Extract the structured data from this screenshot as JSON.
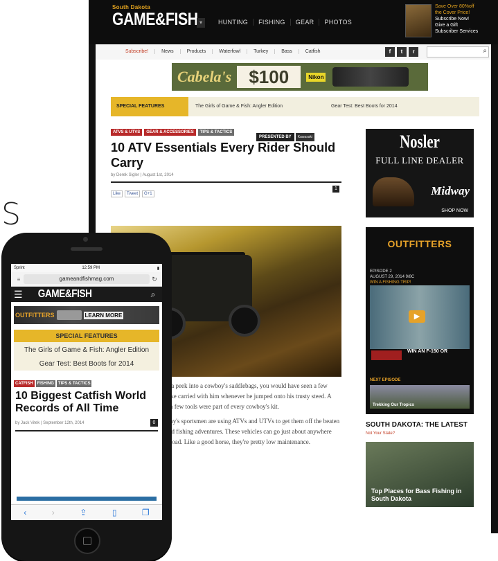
{
  "clip_letter": "S",
  "desktop": {
    "logo_top": "South Dakota",
    "logo_main": "GAME&FISH",
    "nav": [
      "HUNTING",
      "FISHING",
      "GEAR",
      "PHOTOS"
    ],
    "promo": {
      "line1": "Save Over 80%off",
      "line2": "the Cover Price!",
      "line3": "Subscribe Now!",
      "line4": "Give a Gift",
      "line5": "Subscriber Services"
    },
    "subnav": [
      "Subscribe!",
      "News",
      "Products",
      "Waterfowl",
      "Turkey",
      "Bass",
      "Catfish"
    ],
    "social": [
      "f",
      "t",
      "r"
    ],
    "search_placeholder": "",
    "ad": {
      "brand": "Cabela's",
      "amount": "$100",
      "nikon": "Nikon"
    },
    "features": {
      "tag": "SPECIAL FEATURES",
      "link1": "The Girls of Game & Fish: Angler Edition",
      "link2": "Gear Test: Best Boots for 2014"
    },
    "article": {
      "tags": [
        "ATVS & UTVS",
        "GEAR & ACCESSORIES",
        "TIPS & TACTICS"
      ],
      "presented_by": "PRESENTED BY",
      "sponsor": "Kawasaki",
      "title": "10 ATV Essentials Every Rider Should Carry",
      "byline": "by Derek Sigler  |  August 1st, 2014",
      "comment_count": "1",
      "share": [
        "Like",
        "Tweet",
        "G+1"
      ],
      "body": [
        "If you could have taken a peek into a cowboy's saddlebags, you would have seen a few things that every cowpoke carried with him whenever he jumped onto his trusty steed. A canteen, coffee pot and a few tools were part of every cowboy's kit.",
        "Rather than a horse, today's sportsmen are using ATVs and UTVs to get them off the beaten path for their hunting and fishing adventures. These vehicles can go just about anywhere and haul just about any load. Like a good horse, they're pretty low maintenance."
      ]
    },
    "sidebar": {
      "nosler": {
        "brand": "Nosler",
        "line": "FULL LINE DEALER",
        "retailer": "Midway",
        "cta": "SHOP NOW"
      },
      "outfitters": {
        "title": "OUTFITTERS",
        "ep_label": "EPISODE 2",
        "ep_date": "AUGUST 29, 2014 9/8C",
        "ep_cta": "WIN A FISHING TRIP!",
        "win": "WIN AN F-150 OR",
        "next_label": "NEXT EPISODE",
        "next_caption": "Trekking Our Tropics"
      },
      "latest_title": "SOUTH DAKOTA: THE LATEST",
      "latest_sub": "Not Your State?",
      "card_caption": "Top Places for Bass Fishing in South Dakota"
    }
  },
  "phone": {
    "status_left": "Sprint",
    "status_time": "12:59 PM",
    "url": "gameandfishmag.com",
    "logo": "GAME&FISH",
    "ad_brand": "OUTFITTERS",
    "ad_cta": "LEARN MORE",
    "features_tag": "SPECIAL FEATURES",
    "feature1": "The Girls of Game & Fish: Angler Edition",
    "feature2": "Gear Test: Best Boots for 2014",
    "tags": [
      "CATFISH",
      "FISHING",
      "TIPS & TACTICS"
    ],
    "title": "10 Biggest Catfish World Records of All Time",
    "byline": "by Jack Vitek  |  September 12th, 2014",
    "comment_count": "0"
  }
}
